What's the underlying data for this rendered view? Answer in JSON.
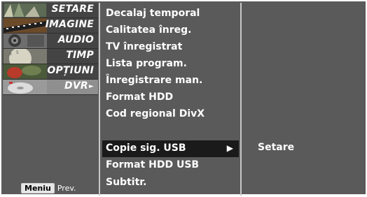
{
  "sidebar": {
    "items": [
      {
        "label": "SETARE",
        "icon": "setup-thumbnail-icon",
        "selected": false
      },
      {
        "label": "IMAGINE",
        "icon": "picture-filmstrip-icon",
        "selected": false
      },
      {
        "label": "AUDIO",
        "icon": "speaker-icon",
        "selected": false
      },
      {
        "label": "TIMP",
        "icon": "clock-icon",
        "selected": false
      },
      {
        "label": "OPȚIUNI",
        "icon": "special-option-icon",
        "selected": false
      },
      {
        "label": "DVR",
        "icon": "disc-icon",
        "selected": true
      }
    ]
  },
  "menu": {
    "items": [
      {
        "label": "Decalaj temporal"
      },
      {
        "label": "Calitatea înreg."
      },
      {
        "label": "TV înregistrat"
      },
      {
        "label": "Lista program."
      },
      {
        "label": "Înregistrare man."
      },
      {
        "label": "Format HDD"
      },
      {
        "label": "Cod regional DivX"
      },
      {
        "label": "Copie sig. USB",
        "selected": true,
        "submenu_arrow": "▶"
      },
      {
        "label": "Format HDD USB"
      },
      {
        "label": "Subtitr."
      }
    ]
  },
  "submenu": {
    "value": "Setare"
  },
  "footer": {
    "key_label": "Meniu",
    "text": "Prev."
  },
  "colors": {
    "panel": "#5a5a5a",
    "selected_row": "#1a1a1a",
    "selected_category": "#8f8f8f",
    "text": "#ffffff"
  }
}
